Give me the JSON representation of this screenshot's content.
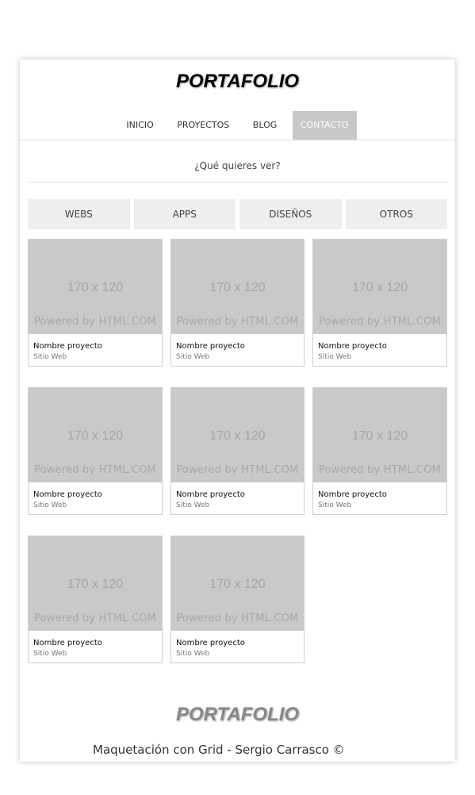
{
  "header": {
    "title": "PORTAFOLIO"
  },
  "nav": {
    "items": [
      {
        "label": "INICIO",
        "active": false
      },
      {
        "label": "PROYECTOS",
        "active": false
      },
      {
        "label": "BLOG",
        "active": false
      },
      {
        "label": "CONTACTO",
        "active": true
      }
    ]
  },
  "question": "¿Qué quieres ver?",
  "filters": [
    "WEBS",
    "APPS",
    "DISEÑOS",
    "OTROS"
  ],
  "projects": [
    {
      "placeholder": "170 x 120",
      "powered": "Powered by HTML.COM",
      "name": "Nombre proyecto",
      "type": "Sitio Web"
    },
    {
      "placeholder": "170 x 120",
      "powered": "Powered by HTML.COM",
      "name": "Nombre proyecto",
      "type": "Sitio Web"
    },
    {
      "placeholder": "170 x 120",
      "powered": "Powered by HTML.COM",
      "name": "Nombre proyecto",
      "type": "Sitio Web"
    },
    {
      "placeholder": "170 x 120",
      "powered": "Powered by HTML.COM",
      "name": "Nombre proyecto",
      "type": "Sitio Web"
    },
    {
      "placeholder": "170 x 120",
      "powered": "Powered by HTML.COM",
      "name": "Nombre proyecto",
      "type": "Sitio Web"
    },
    {
      "placeholder": "170 x 120",
      "powered": "Powered by HTML.COM",
      "name": "Nombre proyecto",
      "type": "Sitio Web"
    },
    {
      "placeholder": "170 x 120",
      "powered": "Powered by HTML.COM",
      "name": "Nombre proyecto",
      "type": "Sitio Web"
    },
    {
      "placeholder": "170 x 120",
      "powered": "Powered by HTML.COM",
      "name": "Nombre proyecto",
      "type": "Sitio Web"
    }
  ],
  "footer": {
    "title": "PORTAFOLIO",
    "credit": "Maquetación con Grid - Sergio Carrasco ©"
  },
  "colors": {
    "nav_active_bg": "#c8c8c8",
    "thumb_bg": "#c9c9c9",
    "filter_bg": "#eeeeee"
  }
}
